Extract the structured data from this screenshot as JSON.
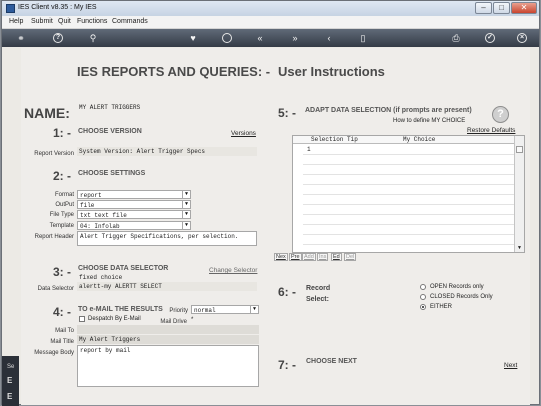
{
  "window": {
    "title": "IES Client v8.35 : My IES",
    "min_label": "–",
    "max_label": "□",
    "close_label": "✕"
  },
  "menu": {
    "items": [
      "Help",
      "Submit",
      "Quit",
      "Functions",
      "Commands"
    ]
  },
  "toolbar": {
    "icons": [
      "key-icon",
      "help-icon",
      "search-icon",
      "heart-icon",
      "history-icon",
      "rewind-icon",
      "fast-forward-icon",
      "back-icon",
      "forward-icon",
      "stop-icon",
      "print-icon",
      "ok-icon",
      "close-icon"
    ]
  },
  "page": {
    "title": "IES REPORTS AND QUERIES: -",
    "subtitle": "User Instructions"
  },
  "name_section": {
    "label": "NAME:",
    "value": "MY ALERT TRIGGERS"
  },
  "step1": {
    "num": "1: -",
    "title": "CHOOSE VERSION",
    "link": "Versions",
    "field_label": "Report Version",
    "value": "System Version: Alert Trigger Specs"
  },
  "step2": {
    "num": "2: -",
    "title": "CHOOSE SETTINGS",
    "format_label": "Format",
    "format_value": "report",
    "output_label": "OutPut",
    "output_value": "file",
    "filetype_label": "File Type",
    "filetype_value": "txt text file",
    "template_label": "Template",
    "template_value": "04: Infolab",
    "header_label": "Report Header",
    "header_value": "Alert Trigger Specifications, per selection."
  },
  "step3": {
    "num": "3: -",
    "title": "CHOOSE DATA SELECTOR",
    "link": "Change Selector",
    "choice": "fixed choice",
    "field_label": "Data Selector",
    "value": "alertt-my ALERTT SELECT"
  },
  "step4": {
    "num": "4: -",
    "title": "TO e-MAIL THE RESULTS",
    "priority_label": "Priority",
    "priority_value": "normal",
    "despatch_label": "Despatch By E-Mail",
    "maildrive_label": "Mail Drive",
    "maildrive_value": "*",
    "mailto_label": "Mail To",
    "mailtitle_label": "Mail Title",
    "mailtitle_value": "My Alert Triggers",
    "body_label": "Message Body",
    "body_value": "report by mail"
  },
  "step5": {
    "num": "5: -",
    "title": "ADAPT DATA SELECTION (if prompts are present)",
    "howto": "How to define MY CHOICE",
    "restore": "Restore Defaults",
    "col1": "Selection Tip",
    "col2": "My Choice",
    "row1": "1",
    "buttons": [
      "Nex",
      "Pre",
      "Add",
      "Ins",
      "Ed",
      "Del"
    ]
  },
  "step6": {
    "num": "6: -",
    "label1": "Record",
    "label2": "Select:",
    "options": [
      "OPEN Records only",
      "CLOSED Records Only",
      "EITHER"
    ],
    "selected": 2
  },
  "step7": {
    "num": "7: -",
    "title": "CHOOSE NEXT",
    "next": "Next"
  },
  "left_edge": {
    "text1": "Se",
    "text2": "E",
    "text3": "E"
  }
}
